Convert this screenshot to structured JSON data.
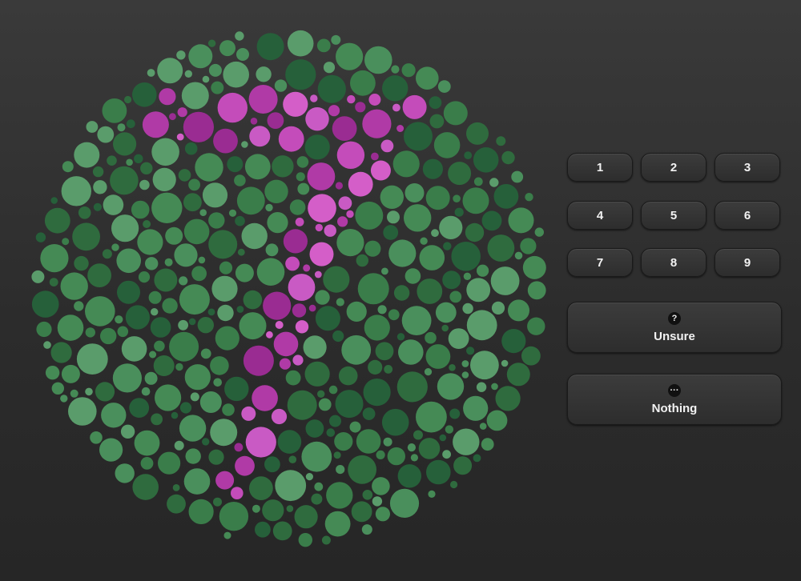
{
  "plate": {
    "figure": "7",
    "colors": {
      "background_dots": [
        "#2f6b3e",
        "#3a7d4a",
        "#4a8f5c",
        "#5a9c6b",
        "#26603a",
        "#458a55"
      ],
      "figure_dots": [
        "#b03aa6",
        "#c44cba",
        "#d45ec8",
        "#9a2c92",
        "#c95ac4"
      ]
    }
  },
  "keypad": {
    "keys": [
      "1",
      "2",
      "3",
      "4",
      "5",
      "6",
      "7",
      "8",
      "9"
    ]
  },
  "unsure": {
    "icon": "question-icon",
    "icon_glyph": "?",
    "label": "Unsure"
  },
  "nothing": {
    "icon": "ellipsis-icon",
    "icon_glyph": "···",
    "label": "Nothing"
  }
}
